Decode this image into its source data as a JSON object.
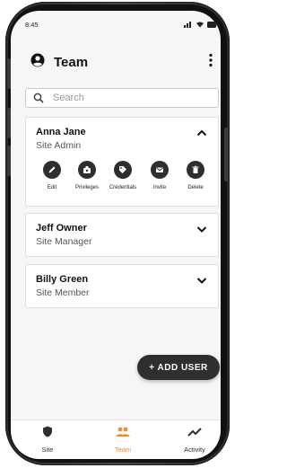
{
  "status_bar": {
    "time": "8:45"
  },
  "app_bar": {
    "title": "Team"
  },
  "search": {
    "placeholder": "Search",
    "value": ""
  },
  "members": [
    {
      "name": "Anna Jane",
      "role": "Site Admin",
      "expanded": true,
      "actions": [
        "Edit",
        "Privileges",
        "Credentials",
        "Invite",
        "Delete"
      ]
    },
    {
      "name": "Jeff Owner",
      "role": "Site Manager",
      "expanded": false
    },
    {
      "name": "Billy Green",
      "role": "Site Member",
      "expanded": false
    }
  ],
  "fab": {
    "label": "+ ADD USER"
  },
  "bottom_nav": [
    {
      "label": "Site",
      "icon": "shield-icon",
      "active": false
    },
    {
      "label": "Team",
      "icon": "people-icon",
      "active": true
    },
    {
      "label": "Activity",
      "icon": "trending-icon",
      "active": false
    }
  ],
  "colors": {
    "accent": "#f28c28",
    "dark": "#2e2e2e",
    "background": "#f6f6f6"
  }
}
